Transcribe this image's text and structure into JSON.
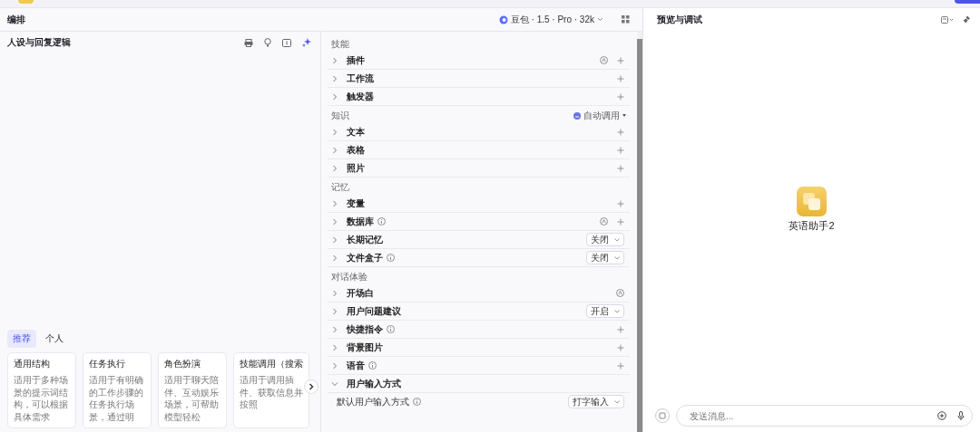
{
  "editor": {
    "title": "编排",
    "model": "豆包 · 1.5 · Pro · 32k"
  },
  "prompt": {
    "title": "人设与回复逻辑"
  },
  "templates": {
    "tabs": [
      {
        "label": "推荐",
        "selected": true
      },
      {
        "label": "个人",
        "selected": false
      }
    ],
    "cards": [
      {
        "title": "通用结构",
        "desc": "适用于多种场景的提示词结构，可以根据具体需求"
      },
      {
        "title": "任务执行",
        "desc": "适用于有明确的工作步骤的任务执行场景，通过明"
      },
      {
        "title": "角色扮演",
        "desc": "适用于聊天陪伴、互动娱乐场景，可帮助模型轻松"
      },
      {
        "title": "技能调用（搜索",
        "desc": "适用于调用插件、获取信息并按照"
      }
    ]
  },
  "sections": [
    {
      "title": "技能",
      "rows": [
        {
          "label": "插件",
          "kind": "auto_add",
          "info": false,
          "expanded": false
        },
        {
          "label": "工作流",
          "kind": "add",
          "info": false,
          "expanded": false
        },
        {
          "label": "触发器",
          "kind": "add",
          "info": false,
          "expanded": false
        }
      ]
    },
    {
      "title": "知识",
      "action": "自动调用",
      "rows": [
        {
          "label": "文本",
          "kind": "add",
          "info": false,
          "expanded": false
        },
        {
          "label": "表格",
          "kind": "add",
          "info": false,
          "expanded": false
        },
        {
          "label": "照片",
          "kind": "add",
          "info": false,
          "expanded": false
        }
      ]
    },
    {
      "title": "记忆",
      "rows": [
        {
          "label": "变量",
          "kind": "add",
          "info": false,
          "expanded": false
        },
        {
          "label": "数据库",
          "kind": "auto_add",
          "info": true,
          "expanded": false
        },
        {
          "label": "长期记忆",
          "kind": "select",
          "value": "关闭",
          "info": false,
          "expanded": false
        },
        {
          "label": "文件盒子",
          "kind": "select",
          "value": "关闭",
          "info": true,
          "expanded": false
        }
      ]
    },
    {
      "title": "对话体验",
      "rows": [
        {
          "label": "开场白",
          "kind": "auto",
          "info": false,
          "expanded": false
        },
        {
          "label": "用户问题建议",
          "kind": "select",
          "value": "开启",
          "info": false,
          "expanded": false
        },
        {
          "label": "快捷指令",
          "kind": "add",
          "info": true,
          "expanded": false
        },
        {
          "label": "背景图片",
          "kind": "add",
          "info": false,
          "expanded": false
        },
        {
          "label": "语音",
          "kind": "add",
          "info": true,
          "expanded": false
        },
        {
          "label": "用户输入方式",
          "kind": "plain",
          "info": false,
          "expanded": true,
          "setting": {
            "label": "默认用户输入方式",
            "value": "打字输入"
          }
        }
      ]
    }
  ],
  "preview": {
    "title": "预览与调试",
    "bot_name": "英语助手2",
    "input": {
      "placeholder": "发送消息..."
    }
  }
}
